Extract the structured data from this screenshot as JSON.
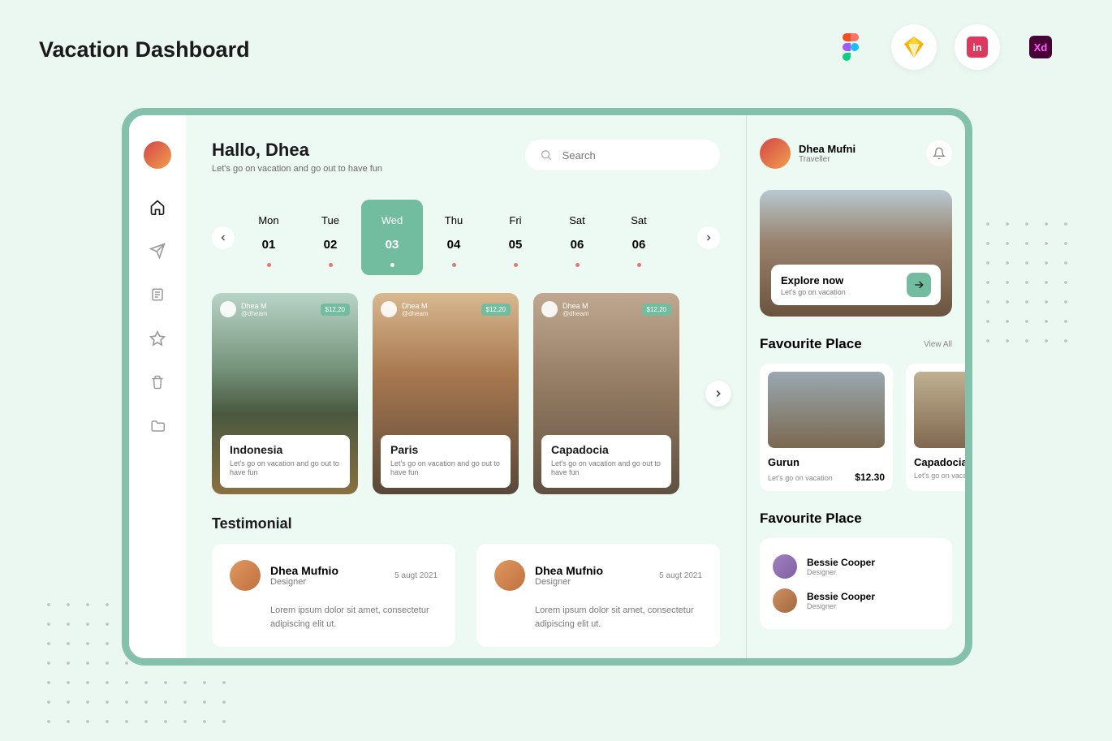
{
  "page_title": "Vacation Dashboard",
  "greeting": {
    "title": "Hallo, Dhea",
    "subtitle": "Let's go on vacation and go out to have fun"
  },
  "search": {
    "placeholder": "Search"
  },
  "calendar": [
    {
      "day": "Mon",
      "num": "01"
    },
    {
      "day": "Tue",
      "num": "02"
    },
    {
      "day": "Wed",
      "num": "03",
      "active": true
    },
    {
      "day": "Thu",
      "num": "04"
    },
    {
      "day": "Fri",
      "num": "05"
    },
    {
      "day": "Sat",
      "num": "06"
    },
    {
      "day": "Sat",
      "num": "06"
    }
  ],
  "trips": [
    {
      "user": "Dhea M",
      "handle": "@dheam",
      "price": "$12,20",
      "title": "Indonesia",
      "desc": "Let's go on vacation and go out to have fun"
    },
    {
      "user": "Dhea M",
      "handle": "@dheam",
      "price": "$12,20",
      "title": "Paris",
      "desc": "Let's go on vacation and go out to have fun"
    },
    {
      "user": "Dhea M",
      "handle": "@dheam",
      "price": "$12,20",
      "title": "Capadocia",
      "desc": "Let's go on vacation and go out to have fun"
    }
  ],
  "testimonial_title": "Testimonial",
  "testimonials": [
    {
      "name": "Dhea Mufnio",
      "role": "Designer",
      "date": "5 augt 2021",
      "body": "Lorem ipsum dolor sit amet, consectetur adipiscing elit ut."
    },
    {
      "name": "Dhea Mufnio",
      "role": "Designer",
      "date": "5 augt 2021",
      "body": "Lorem ipsum dolor sit amet, consectetur adipiscing elit ut."
    }
  ],
  "profile": {
    "name": "Dhea Mufni",
    "role": "Traveller"
  },
  "promo": {
    "title": "Explore now",
    "subtitle": "Let's go on vacation"
  },
  "fav_title": "Favourite Place",
  "view_all": "View All",
  "favs": [
    {
      "title": "Gurun",
      "sub": "Let's go on vacation",
      "price": "$12.30"
    },
    {
      "title": "Capadocia",
      "sub": "Let's go on vacation",
      "price": ""
    }
  ],
  "fav_title2": "Favourite Place",
  "people": [
    {
      "name": "Bessie Cooper",
      "role": "Designer"
    },
    {
      "name": "Bessie Cooper",
      "role": "Designer"
    }
  ]
}
